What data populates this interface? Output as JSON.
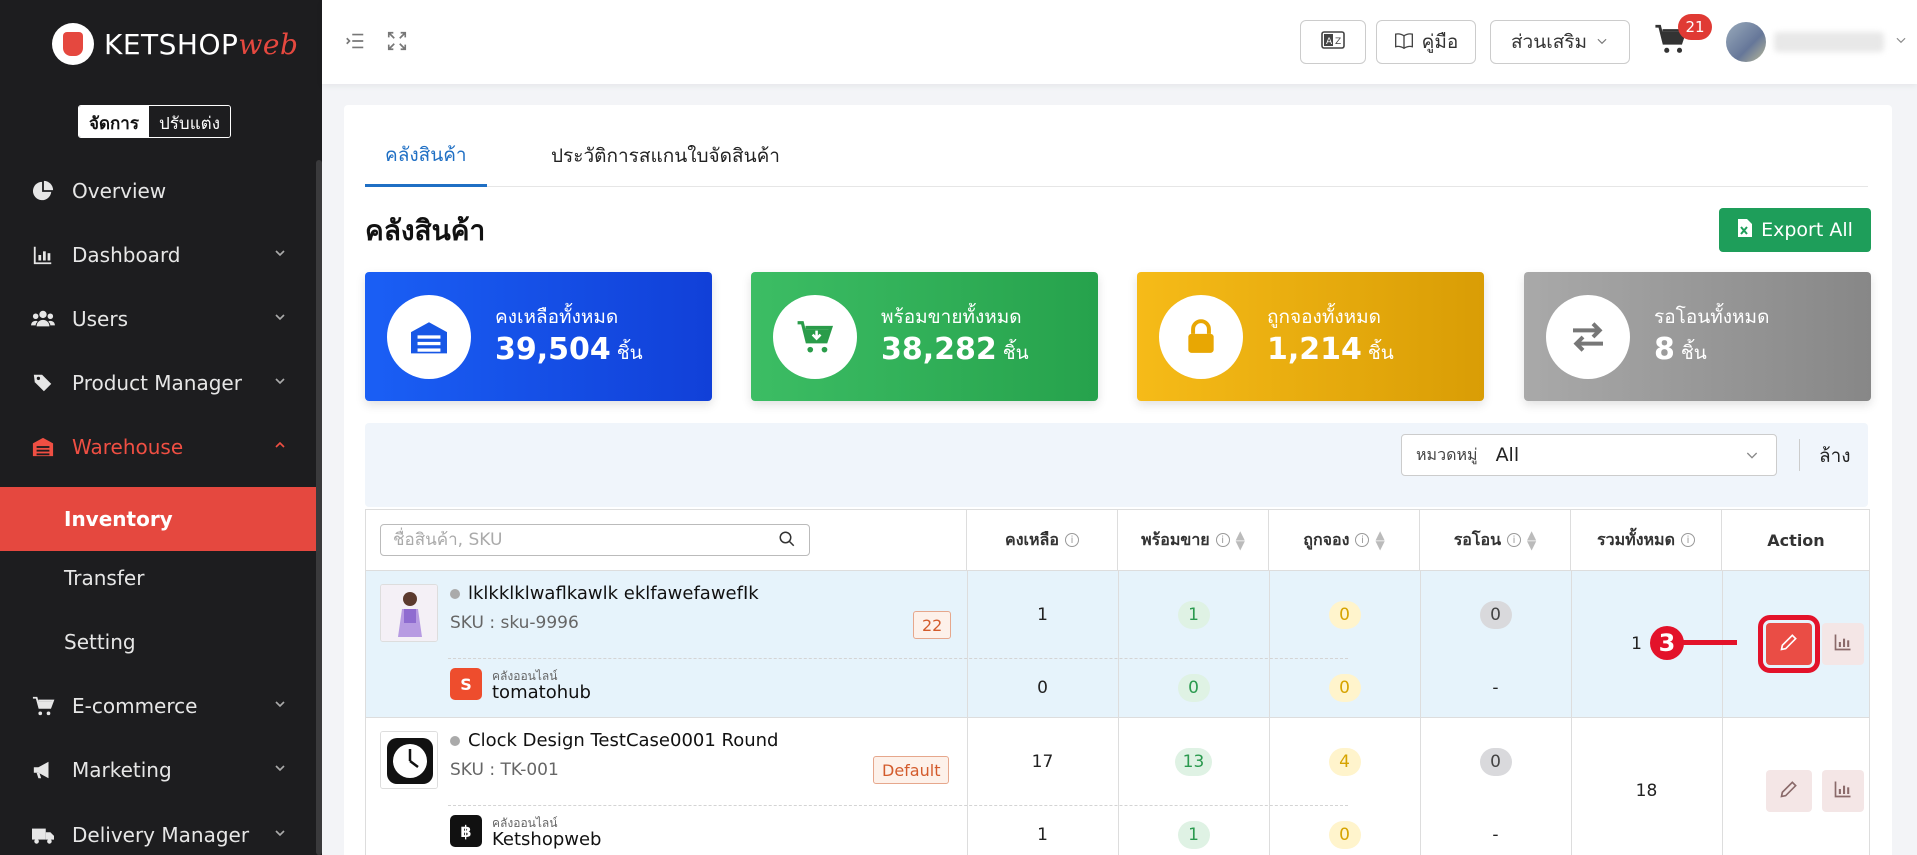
{
  "brand": {
    "name": "KETSHOP",
    "suffix": "web"
  },
  "mode_toggle": {
    "manage": "จัดการ",
    "customize": "ปรับแต่ง"
  },
  "sidebar": {
    "items": [
      {
        "label": "Overview",
        "icon": "pie-chart-icon"
      },
      {
        "label": "Dashboard",
        "icon": "bar-chart-icon"
      },
      {
        "label": "Users",
        "icon": "users-icon"
      },
      {
        "label": "Product Manager",
        "icon": "tag-icon"
      },
      {
        "label": "Warehouse",
        "icon": "warehouse-icon"
      },
      {
        "label": "E-commerce",
        "icon": "cart-icon"
      },
      {
        "label": "Marketing",
        "icon": "megaphone-icon"
      },
      {
        "label": "Delivery Manager",
        "icon": "truck-icon"
      }
    ],
    "warehouse_sub": [
      "Inventory",
      "Transfer",
      "Setting"
    ]
  },
  "topbar": {
    "manual_label": "คู่มือ",
    "addons_label": "ส่วนเสริม",
    "cart_count": "21"
  },
  "tabs": [
    "คลังสินค้า",
    "ประวัติการสแกนใบจัดสินค้า"
  ],
  "page_title": "คลังสินค้า",
  "export_label": "Export All",
  "stats": [
    {
      "label": "คงเหลือทั้งหมด",
      "value": "39,504",
      "unit": "ชิ้น",
      "color": "#1754e8"
    },
    {
      "label": "พร้อมขายทั้งหมด",
      "value": "38,282",
      "unit": "ชิ้น",
      "color": "#2eaa55"
    },
    {
      "label": "ถูกจองทั้งหมด",
      "value": "1,214",
      "unit": "ชิ้น",
      "color": "#f0b10a"
    },
    {
      "label": "รอโอนทั้งหมด",
      "value": "8",
      "unit": "ชิ้น",
      "color": "#9a9a9a"
    }
  ],
  "filter": {
    "label": "หมวดหมู่",
    "value": "All",
    "clear": "ล้าง"
  },
  "table": {
    "search_placeholder": "ชื่อสินค้า, SKU",
    "columns": [
      "คงเหลือ",
      "พร้อมขาย",
      "ถูกจอง",
      "รอโอน",
      "รวมทั้งหมด",
      "Action"
    ],
    "rows": [
      {
        "name": "lklkklklwaflkawlk eklfawefawefIk",
        "sku": "SKU : sku-9996",
        "badge": "22",
        "main": {
          "remain": "1",
          "ready": "1",
          "reserved": "0",
          "transfer": "0"
        },
        "channel_label": "คลังออนไลน์",
        "channel": "tomatohub",
        "channel_vals": {
          "remain": "0",
          "ready": "0",
          "reserved": "0",
          "transfer": "-"
        },
        "total": "1"
      },
      {
        "name": "Clock Design TestCase0001 Round",
        "sku": "SKU : TK-001",
        "badge": "Default",
        "main": {
          "remain": "17",
          "ready": "13",
          "reserved": "4",
          "transfer": "0"
        },
        "channel_label": "คลังออนไลน์",
        "channel": "Ketshopweb",
        "channel_vals": {
          "remain": "1",
          "ready": "1",
          "reserved": "0",
          "transfer": "-"
        },
        "total": "18"
      }
    ]
  },
  "annotation": "3"
}
